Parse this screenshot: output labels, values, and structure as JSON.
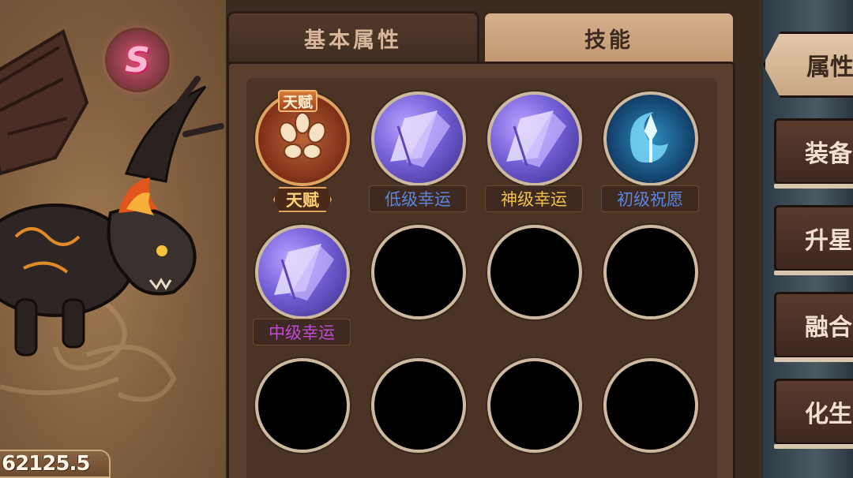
{
  "pet": {
    "grade": "S",
    "power": "62125.5"
  },
  "tabs": [
    {
      "label": "基本属性",
      "active": false
    },
    {
      "label": "技能",
      "active": true
    }
  ],
  "skills": {
    "talent_tag": "天赋",
    "slots": [
      {
        "name": "天赋",
        "icon": "talent-claw-icon",
        "label_color": "#ffcf7a"
      },
      {
        "name": "低级幸运",
        "icon": "luck-purple-icon",
        "label_color": "#5b86e0"
      },
      {
        "name": "神级幸运",
        "icon": "luck-purple-icon",
        "label_color": "#f0c24a"
      },
      {
        "name": "初级祝愿",
        "icon": "blessing-blue-icon",
        "label_color": "#5b86e0"
      },
      {
        "name": "中级幸运",
        "icon": "luck-purple-icon",
        "label_color": "#c04ad8"
      }
    ]
  },
  "side_menu": [
    {
      "label": "属性"
    },
    {
      "label": "装备"
    },
    {
      "label": "升星"
    },
    {
      "label": "融合"
    },
    {
      "label": "化生"
    }
  ]
}
